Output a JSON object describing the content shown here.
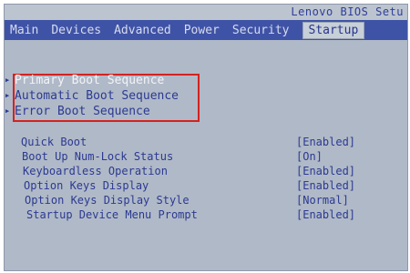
{
  "window": {
    "title": "Lenovo BIOS Setu"
  },
  "tabs": [
    "Main",
    "Devices",
    "Advanced",
    "Power",
    "Security",
    "Startup"
  ],
  "active_tab": "Startup",
  "sequences": [
    {
      "label": "Primary Boot Sequence",
      "selected": true
    },
    {
      "label": "Automatic Boot Sequence",
      "selected": false
    },
    {
      "label": "Error Boot Sequence",
      "selected": false
    }
  ],
  "options": [
    {
      "label": "Quick Boot",
      "value": "[Enabled]"
    },
    {
      "label": "Boot Up Num-Lock Status",
      "value": "[On]"
    },
    {
      "label": "Keyboardless Operation",
      "value": "[Enabled]"
    },
    {
      "label": "Option Keys Display",
      "value": "[Enabled]"
    },
    {
      "label": "Option Keys Display Style",
      "value": "[Normal]"
    },
    {
      "label": "Startup Device Menu Prompt",
      "value": "[Enabled]"
    }
  ],
  "colors": {
    "menubar": "#3f53a6",
    "active_tab": "#c7cfd8",
    "text": "#2b3a92",
    "highlight_box": "#d4221f"
  }
}
